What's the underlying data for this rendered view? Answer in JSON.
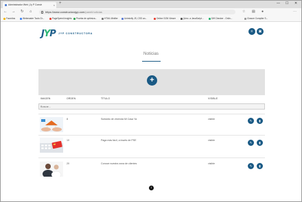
{
  "browser": {
    "tab_title": "Administrador Web | Jy P Constr",
    "tab_close": "×",
    "new_tab": "+",
    "url_domain": "https://www.constructorajyp.com",
    "url_path": "/panel/noticias",
    "back": "←",
    "forward": "→",
    "reload": "↻",
    "home": "⌂",
    "min": "—",
    "max": "☐",
    "close": "✕",
    "bookmarks": [
      {
        "label": "Favoritos",
        "color": "#f2b600"
      },
      {
        "label": "Webmaster Tools Gr...",
        "color": "#4285f4"
      },
      {
        "label": "PageSpeed Insights",
        "color": "#e94235"
      },
      {
        "label": "Prueba de optimiza...",
        "color": "#34a853"
      },
      {
        "label": "HTML Minifier",
        "color": "#777777"
      },
      {
        "label": "Uniminify JS, CSS an...",
        "color": "#5b7bd5"
      },
      {
        "label": "Online GON Viewer",
        "color": "#e94235"
      },
      {
        "label": "(Umc. a JavaScript...",
        "color": "#555555"
      },
      {
        "label": "Diff Checker - Onlin...",
        "color": "#2bb673"
      },
      {
        "label": "Closure Compiler S...",
        "color": "#999999"
      }
    ]
  },
  "header": {
    "logo_mark_j": "J",
    "logo_mark_y": "Y",
    "logo_mark_p": "P",
    "logo_text": "JYP CONSTRUCTORA",
    "menu_icon": "≡",
    "user_icon": "▣"
  },
  "page": {
    "title": "Noticias",
    "add_label": "+",
    "search_placeholder": "Buscar...",
    "pager_current": "1"
  },
  "table": {
    "headers": {
      "image": "IMAGEN",
      "order": "ORDEN",
      "title": "TÍTULO",
      "visible": "VISIBLE"
    },
    "rows": [
      {
        "order": "8",
        "title": "Subsidio de vivienda Mi Casa Ya",
        "visible": "visible",
        "thumb": "house-hands"
      },
      {
        "order": "10",
        "title": "Paga más fácil, a través de PSE",
        "visible": "visible",
        "thumb": "card-keyboard"
      },
      {
        "order": "20",
        "title": "Conoce nuestra zona de clientes",
        "visible": "visible",
        "thumb": "customer-service"
      }
    ],
    "edit_icon": "✎",
    "delete_icon": "▮"
  },
  "colors": {
    "primary": "#1a5a85",
    "accent": "#2bb673",
    "hero_bg": "#e2e2e2"
  }
}
